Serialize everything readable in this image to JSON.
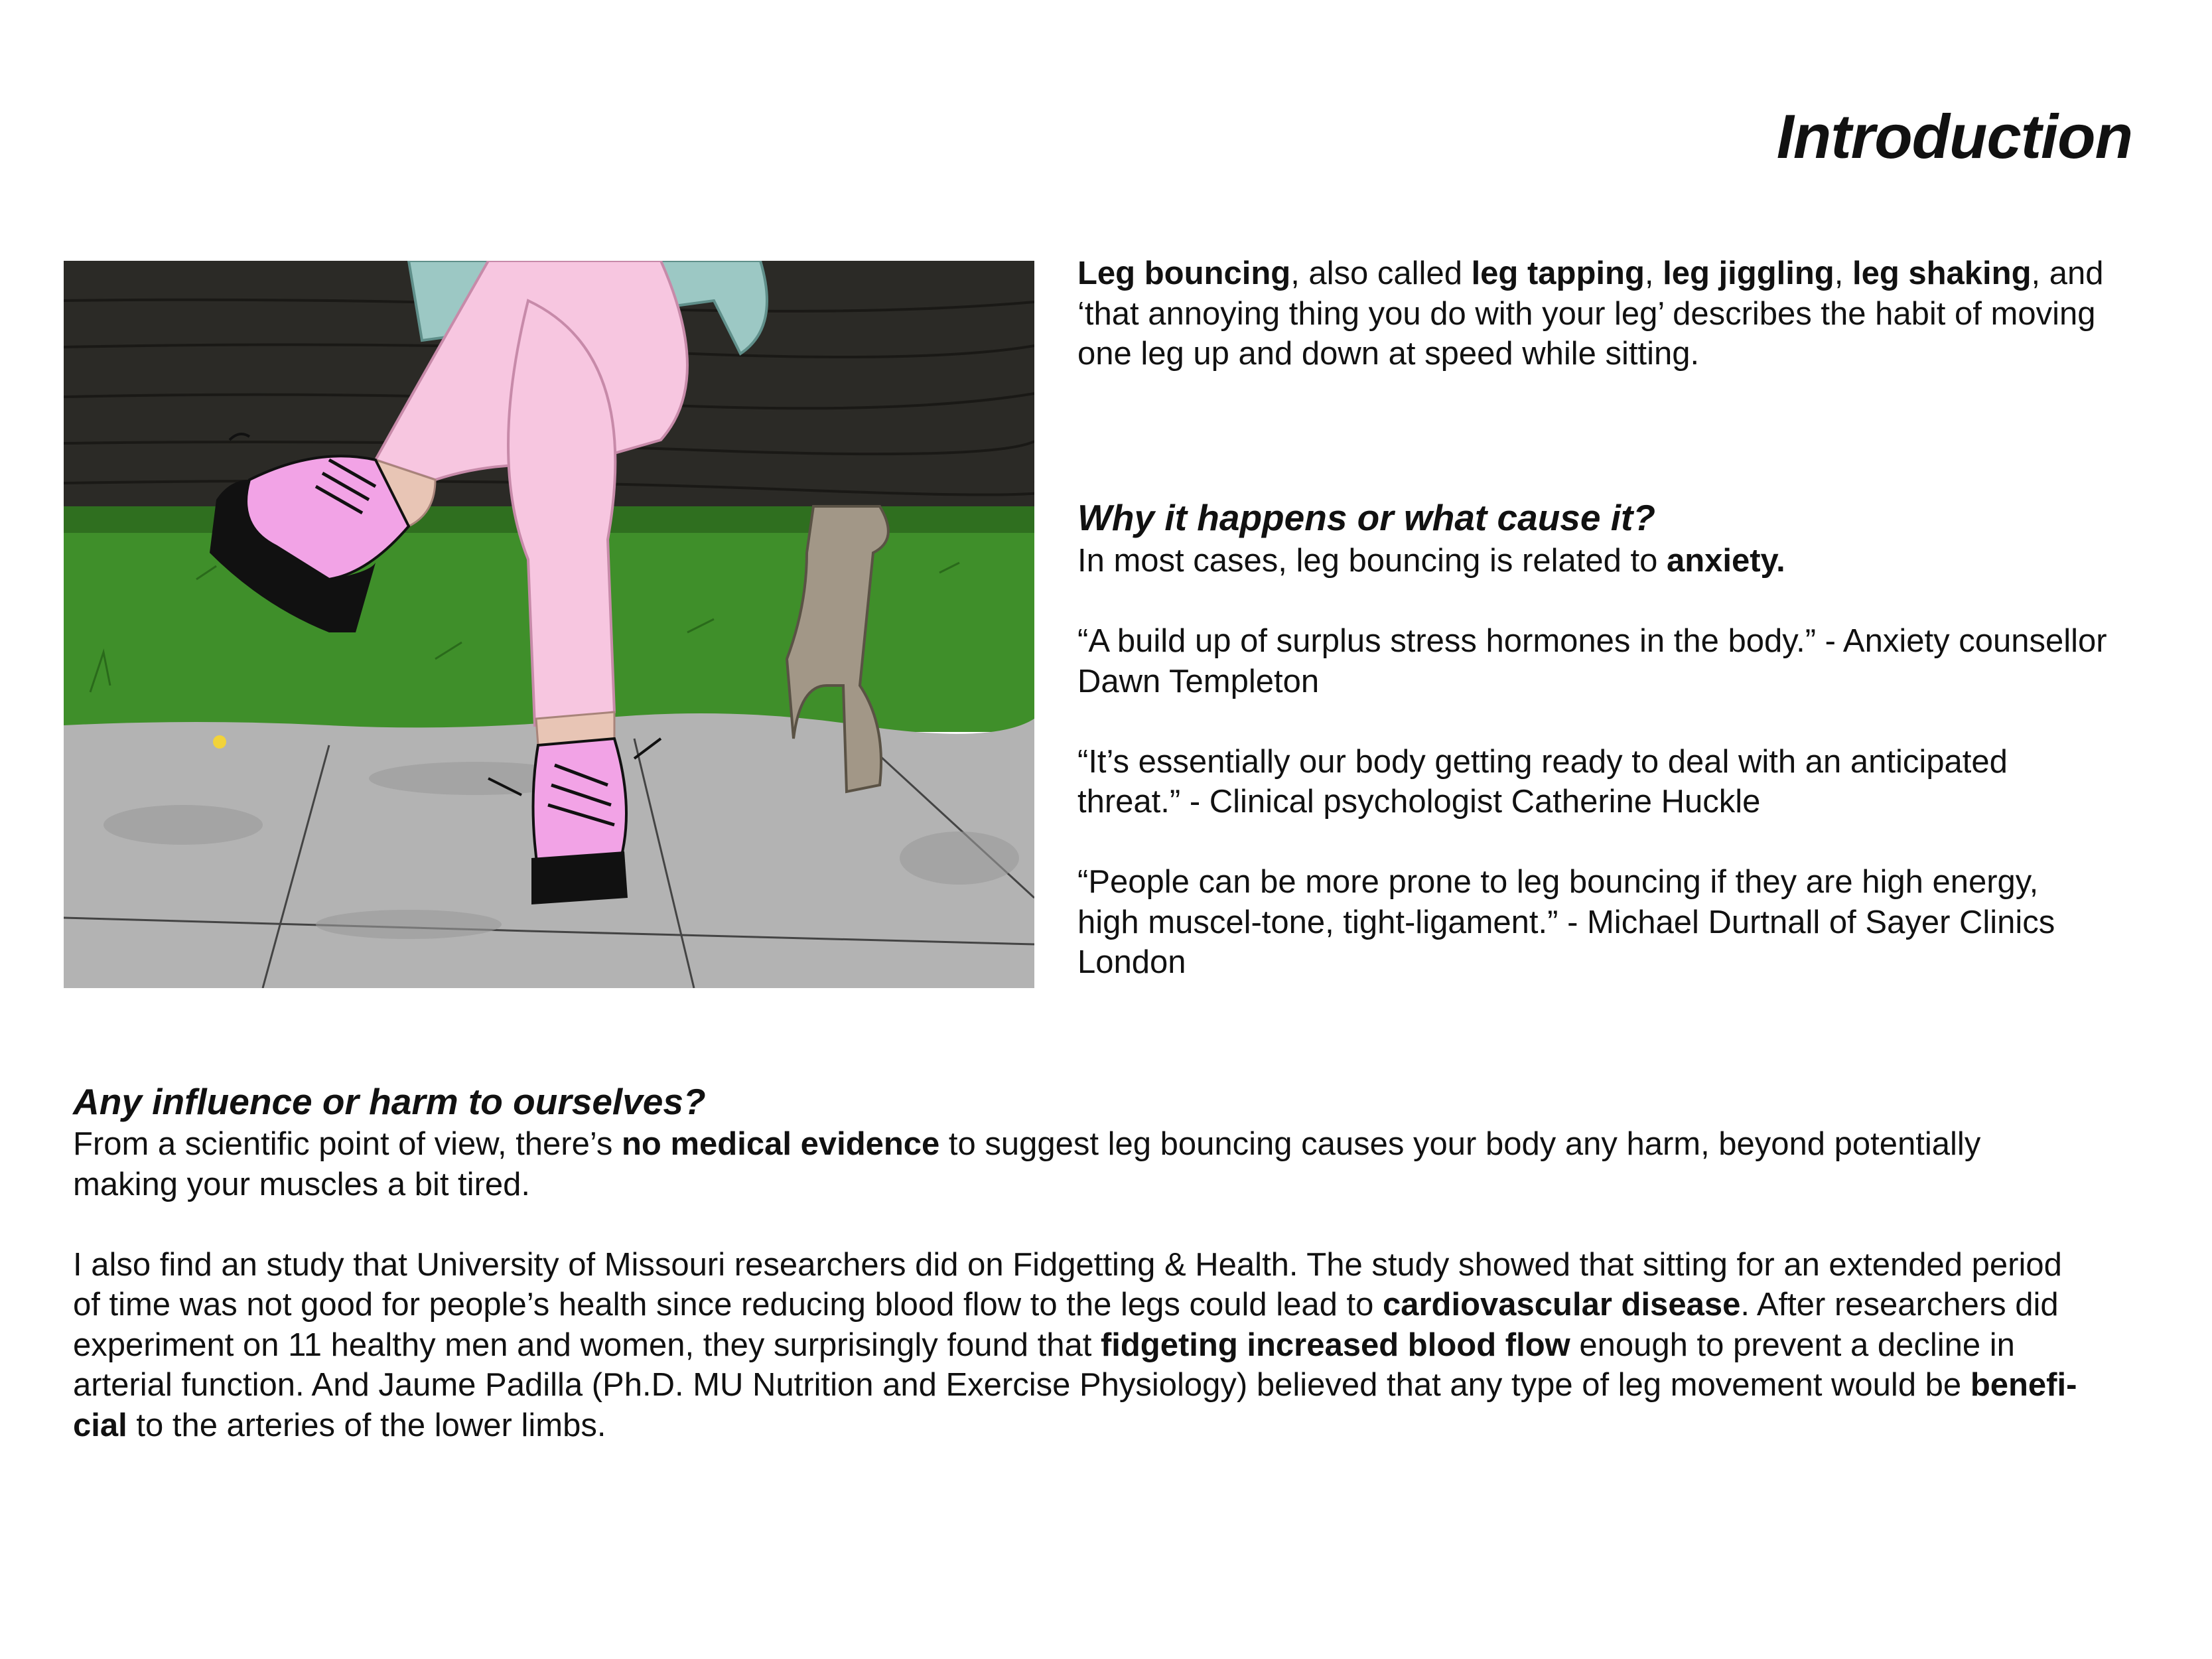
{
  "page": {
    "title": "Introduction"
  },
  "intro": {
    "t1": "Leg bouncing",
    "t2": ", also called ",
    "t3": "leg tapping",
    "t4": ", ",
    "t5": "leg jiggling",
    "t6": ", ",
    "t7": "leg shaking",
    "t8": ", and",
    "l2": "‘that annoying thing you do with your leg’ describes the habit of moving",
    "l3": "one leg up and down at speed while sitting."
  },
  "why": {
    "heading": "Why it happens or what cause it?",
    "p1_a": "In most cases, leg bouncing is related to ",
    "p1_b": "anxiety.",
    "q1_l1": "“A build up of surplus stress hormones in the body.” - Anxiety counsellor",
    "q1_l2": "Dawn Templeton",
    "q2_l1": "“It’s essentially our body getting ready to deal with an anticipated",
    "q2_l2": "threat.” - Clinical psychologist Catherine Huckle",
    "q3_l1": "“People can be more prone to leg bouncing if they are high energy,",
    "q3_l2": "high muscel-tone, tight-ligament.” - Michael Durtnall of Sayer Clinics",
    "q3_l3": "London"
  },
  "harm": {
    "heading": "Any influence or harm to ourselves?",
    "p1_a": "From a scientific point of view, there’s ",
    "p1_b": "no medical evidence",
    "p1_c": " to suggest leg bouncing causes your body any harm, beyond potentially",
    "p1_l2": "making your muscles a bit tired.",
    "p2_l1": "I also find an study that University of Missouri researchers did on Fidgetting & Health. The study showed that sitting for an extended period",
    "p2_l2_a": "of time was not good for people’s health since reducing blood flow to the legs could lead to ",
    "p2_l2_b": "cardiovascular disease",
    "p2_l2_c": ". After researchers did",
    "p2_l3_a": "experiment on 11 healthy men and women, they surprisingly found that ",
    "p2_l3_b": "fidgeting increased blood flow",
    "p2_l3_c": " enough to prevent a decline in",
    "p2_l4_a": "arterial function. And Jaume Padilla (Ph.D. MU Nutrition and Exercise Physiology) believed that any type of leg movement would be ",
    "p2_l4_b": "benefi-",
    "p2_l5_a": "cial",
    "p2_l5_b": " to the arteries of the lower limbs."
  },
  "illustration": {
    "colors": {
      "bench": "#2b2a26",
      "grass": "#3f8f2a",
      "pavement": "#b3b3b3",
      "pants": "#f7c6e0",
      "shoe": "#f2a3e6",
      "sole": "#111111",
      "jacket": "#9cc8c4",
      "bench_leg": "#a29787"
    }
  }
}
